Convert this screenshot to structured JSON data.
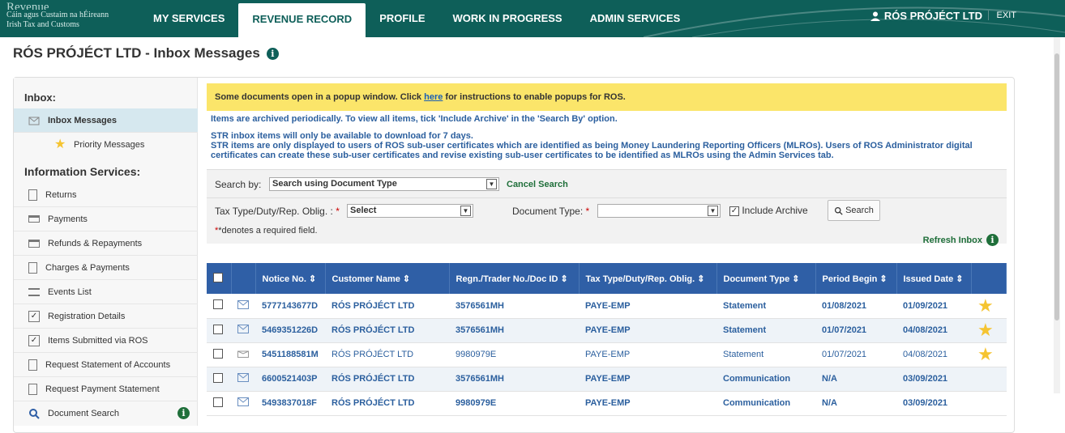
{
  "logo": {
    "big": "Revenue",
    "line1": "Cáin agus Custaim na hÉireann",
    "line2": "Irish Tax and Customs"
  },
  "nav": [
    {
      "label": "MY SERVICES",
      "active": false
    },
    {
      "label": "REVENUE RECORD",
      "active": true
    },
    {
      "label": "PROFILE",
      "active": false
    },
    {
      "label": "WORK IN PROGRESS",
      "active": false
    },
    {
      "label": "ADMIN SERVICES",
      "active": false
    }
  ],
  "user": {
    "name": "RÓS PRÓJÉCT LTD",
    "exit": "EXIT"
  },
  "page_title": "RÓS PRÓJÉCT LTD - Inbox Messages",
  "sidebar": {
    "inbox_heading": "Inbox:",
    "info_heading": "Information Services:",
    "inbox_items": [
      "Inbox Messages",
      "Priority Messages"
    ],
    "items": [
      "Returns",
      "Payments",
      "Refunds & Repayments",
      "Charges & Payments",
      "Events List",
      "Registration Details",
      "Items Submitted via ROS",
      "Request Statement of Accounts",
      "Request Payment Statement",
      "Document Search"
    ]
  },
  "banner": {
    "pre": "Some documents open in a popup window. Click ",
    "link": "here",
    "post": " for instructions to enable popups for ROS."
  },
  "notes": {
    "archive": "Items are archived periodically. To view all items, tick 'Include Archive' in the 'Search By' option.",
    "str1": "STR inbox items will only be available to download for 7 days.",
    "str2": "STR items are only displayed to users of ROS sub-user certificates which are identified as being Money Laundering Reporting Officers (MLROs). Users of ROS Administrator digital certificates can create these sub-user certificates and revise existing sub-user certificates to be identified as MLROs using the Admin Services tab."
  },
  "search": {
    "search_by_label": "Search by:",
    "search_by_value": "Search using Document Type",
    "cancel": "Cancel Search",
    "tax_type_label": "Tax Type/Duty/Rep. Oblig. :",
    "tax_type_value": "Select",
    "doc_type_label": "Document Type:",
    "doc_type_value": "",
    "include_archive": "Include Archive",
    "search_button": "Search",
    "required_note": "*denotes a required field.",
    "refresh": "Refresh Inbox"
  },
  "table": {
    "headers": [
      "Notice No. ⇕",
      "Customer Name ⇕",
      "Regn./Trader No./Doc ID ⇕",
      "Tax Type/Duty/Rep. Oblig. ⇕",
      "Document Type ⇕",
      "Period Begin ⇕",
      "Issued Date ⇕"
    ],
    "rows": [
      {
        "notice": "5777143677D",
        "customer": "RÓS PRÓJÉCT LTD",
        "regn": "3576561MH",
        "tax": "PAYE-EMP",
        "doctype": "Statement",
        "period": "01/08/2021",
        "issued": "01/09/2021",
        "star": true,
        "read": false
      },
      {
        "notice": "5469351226D",
        "customer": "RÓS PRÓJÉCT LTD",
        "regn": "3576561MH",
        "tax": "PAYE-EMP",
        "doctype": "Statement",
        "period": "01/07/2021",
        "issued": "04/08/2021",
        "star": true,
        "read": false
      },
      {
        "notice": "5451188581M",
        "customer": "RÓS PRÓJÉCT LTD",
        "regn": "9980979E",
        "tax": "PAYE-EMP",
        "doctype": "Statement",
        "period": "01/07/2021",
        "issued": "04/08/2021",
        "star": true,
        "read": true
      },
      {
        "notice": "6600521403P",
        "customer": "RÓS PRÓJÉCT LTD",
        "regn": "3576561MH",
        "tax": "PAYE-EMP",
        "doctype": "Communication",
        "period": "N/A",
        "issued": "03/09/2021",
        "star": false,
        "read": false
      },
      {
        "notice": "5493837018F",
        "customer": "RÓS PRÓJÉCT LTD",
        "regn": "9980979E",
        "tax": "PAYE-EMP",
        "doctype": "Communication",
        "period": "N/A",
        "issued": "03/09/2021",
        "star": false,
        "read": false
      }
    ]
  },
  "colors": {
    "brand": "#0e5f59",
    "header": "#2f5fa6",
    "banner": "#fbe56a",
    "star": "#f5c431"
  }
}
